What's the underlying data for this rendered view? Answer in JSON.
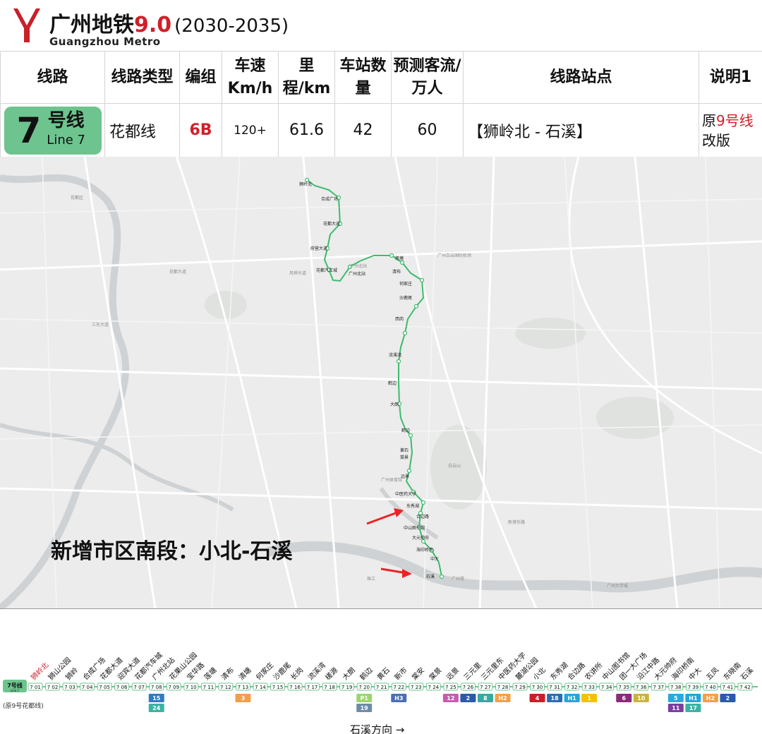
{
  "header": {
    "title_main": "广州地铁",
    "version": "9.0",
    "years": "(2030-2035)",
    "brand_en": "Guangzhou Metro",
    "logo_color": "#c8202a"
  },
  "table": {
    "headers": [
      "线路",
      "线路类型",
      "编组",
      "车速Km/h",
      "里程/km",
      "车站数量",
      "预测客流/万人",
      "线路站点",
      "说明1"
    ],
    "row": {
      "line_num": "7",
      "line_zh": "号线",
      "line_en": "Line 7",
      "line_color": "#6dc48f",
      "type": "花都线",
      "formation": "6B",
      "speed": "120+",
      "length": "61.6",
      "stations": "42",
      "ridership": "60",
      "route": "【狮岭北 - 石溪】",
      "note_pre": "原",
      "note_red": "9号线",
      "note_post": "改版"
    }
  },
  "map": {
    "caption": "新增市区南段：小北-石溪",
    "line_color": "#3dbb6e",
    "stations": [
      "狮岭北",
      "合成广场",
      "花都大道",
      "府营大道",
      "花都汽车城",
      "广州北站",
      "莲塘",
      "清布",
      "何家庄",
      "沙鹿尾",
      "西岗",
      "流溪湾",
      "鹤边",
      "大朗",
      "鹤边",
      "黄石",
      "棠景",
      "远景",
      "中医药大学",
      "东秀湖",
      "合边路",
      "中山图书馆",
      "大元帅府",
      "海印桥南",
      "中大",
      "石溪"
    ],
    "labels": [
      "广州北站",
      "广州白云国际机场",
      "花都大道",
      "风神大道",
      "广州体育馆",
      "白云山",
      "广州塔",
      "花都区",
      "三东大道",
      "珠江",
      "广州大学城",
      "新港东路"
    ]
  },
  "strip": {
    "line_badge": "7号线",
    "line_badge_en": "Line 7",
    "old_note": "(原9号花都线)",
    "direction": "石溪方向 →",
    "stations": [
      {
        "code": "7 01",
        "name": "狮岭北",
        "highlight": true
      },
      {
        "code": "7 02",
        "name": "狮山公园"
      },
      {
        "code": "7 03",
        "name": "狮岭"
      },
      {
        "code": "7 04",
        "name": "合成广场"
      },
      {
        "code": "7 05",
        "name": "花都大道"
      },
      {
        "code": "7 06",
        "name": "迎宾大道"
      },
      {
        "code": "7 07",
        "name": "花都汽车城"
      },
      {
        "code": "7 08",
        "name": "广州北站",
        "transfers": [
          {
            "label": "15",
            "color": "#2f7bc1"
          },
          {
            "label": "24",
            "color": "#3bb3a4"
          }
        ]
      },
      {
        "code": "7 09",
        "name": "花果山公园"
      },
      {
        "code": "7 10",
        "name": "宝华路"
      },
      {
        "code": "7 11",
        "name": "莲塘"
      },
      {
        "code": "7 12",
        "name": "清布"
      },
      {
        "code": "7 13",
        "name": "清塘",
        "transfers": [
          {
            "label": "3",
            "color": "#f0a04b"
          }
        ]
      },
      {
        "code": "7 14",
        "name": "何家庄"
      },
      {
        "code": "7 15",
        "name": "沙鹿尾"
      },
      {
        "code": "7 16",
        "name": "长岗"
      },
      {
        "code": "7 17",
        "name": "流溪湾"
      },
      {
        "code": "7 18",
        "name": "槎源"
      },
      {
        "code": "7 19",
        "name": "大朗"
      },
      {
        "code": "7 20",
        "name": "鹤边",
        "transfers": [
          {
            "label": "P1",
            "color": "#9bd66b"
          },
          {
            "label": "19",
            "color": "#6e8ca8"
          }
        ]
      },
      {
        "code": "7 21",
        "name": "黄石"
      },
      {
        "code": "7 22",
        "name": "新市",
        "transfers": [
          {
            "label": "H3",
            "color": "#4a6fb5"
          }
        ]
      },
      {
        "code": "7 23",
        "name": "棠安"
      },
      {
        "code": "7 24",
        "name": "棠景"
      },
      {
        "code": "7 25",
        "name": "远景",
        "transfers": [
          {
            "label": "12",
            "color": "#c75bb0"
          }
        ]
      },
      {
        "code": "7 26",
        "name": "三元里",
        "transfers": [
          {
            "label": "2",
            "color": "#2a5aa8"
          }
        ]
      },
      {
        "code": "7 27",
        "name": "三元里东",
        "transfers": [
          {
            "label": "8",
            "color": "#3aa7a0"
          }
        ]
      },
      {
        "code": "7 28",
        "name": "中医药大学",
        "transfers": [
          {
            "label": "H2",
            "color": "#f0a04b"
          }
        ]
      },
      {
        "code": "7 29",
        "name": "麓湖公园"
      },
      {
        "code": "7 30",
        "name": "小北",
        "transfers": [
          {
            "label": "4",
            "color": "#c8202a"
          }
        ]
      },
      {
        "code": "7 31",
        "name": "东秀湖",
        "transfers": [
          {
            "label": "18",
            "color": "#2b6cb0"
          }
        ]
      },
      {
        "code": "7 32",
        "name": "合边路",
        "transfers": [
          {
            "label": "H1",
            "color": "#26a5d6"
          }
        ]
      },
      {
        "code": "7 33",
        "name": "农讲所",
        "transfers": [
          {
            "label": "1",
            "color": "#f2c200"
          }
        ]
      },
      {
        "code": "7 34",
        "name": "中山图书馆"
      },
      {
        "code": "7 35",
        "name": "团一大广场",
        "transfers": [
          {
            "label": "6",
            "color": "#8b2a7b"
          }
        ]
      },
      {
        "code": "7 36",
        "name": "沿江中路",
        "transfers": [
          {
            "label": "10",
            "color": "#c8b43a"
          }
        ]
      },
      {
        "code": "7 37",
        "name": "大元帅府"
      },
      {
        "code": "7 38",
        "name": "海印桥南",
        "transfers": [
          {
            "label": "5",
            "color": "#2fa7d9"
          },
          {
            "label": "11",
            "color": "#7b3fa0"
          }
        ]
      },
      {
        "code": "7 39",
        "name": "中大",
        "transfers": [
          {
            "label": "H1",
            "color": "#26a5d6"
          },
          {
            "label": "17",
            "color": "#3bb3a4"
          }
        ]
      },
      {
        "code": "7 40",
        "name": "五凤",
        "transfers": [
          {
            "label": "H2",
            "color": "#f0a04b"
          }
        ]
      },
      {
        "code": "7 41",
        "name": "东晓南",
        "transfers": [
          {
            "label": "2",
            "color": "#2a5aa8"
          }
        ]
      },
      {
        "code": "7 42",
        "name": "石溪"
      }
    ]
  }
}
